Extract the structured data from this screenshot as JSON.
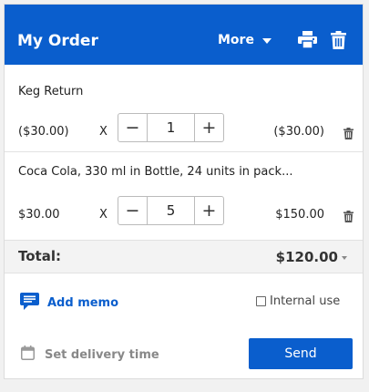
{
  "header": {
    "title": "My Order",
    "more_label": "More",
    "print_icon": "print-icon",
    "trash_icon": "trash-icon"
  },
  "items": [
    {
      "name": "Keg Return",
      "unit_price": "($30.00)",
      "multiplier": "X",
      "quantity": "1",
      "line_total": "($30.00)"
    },
    {
      "name": "Coca Cola, 330 ml in Bottle, 24 units in pack...",
      "unit_price": "$30.00",
      "multiplier": "X",
      "quantity": "5",
      "line_total": "$150.00"
    }
  ],
  "stepper": {
    "minus": "−",
    "plus": "+"
  },
  "total": {
    "label": "Total:",
    "amount": "$120.00"
  },
  "memo": {
    "label": "Add memo"
  },
  "internal_use": {
    "label": "Internal use",
    "checked": false
  },
  "delivery": {
    "label": "Set delivery time"
  },
  "send": {
    "label": "Send"
  },
  "colors": {
    "accent": "#0a5ecd",
    "total_bg": "#f3f3f3"
  }
}
